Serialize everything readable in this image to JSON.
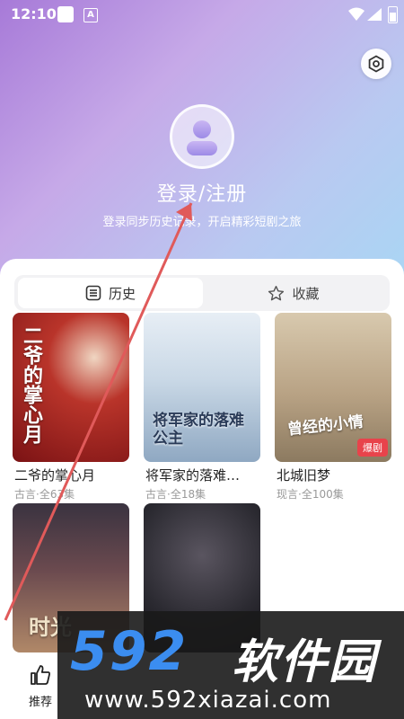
{
  "status_bar": {
    "time": "12:10",
    "notif_icon": "A"
  },
  "header": {
    "settings_icon": "settings-icon",
    "avatar_icon": "user-avatar-icon",
    "login_title": "登录/注册",
    "login_subtitle": "登录同步历史记录，开启精彩短剧之旅"
  },
  "tabs": [
    {
      "label": "历史",
      "icon": "list-icon",
      "active": true
    },
    {
      "label": "收藏",
      "icon": "star-icon",
      "active": false
    }
  ],
  "cards": [
    {
      "title": "二爷的掌心月",
      "meta": "古言·全63集",
      "poster_text": "二爷的掌心月"
    },
    {
      "title": "将军家的落难…",
      "meta": "古言·全18集",
      "poster_text": "将军家的落难公主"
    },
    {
      "title": "北城旧梦",
      "meta": "现言·全100集",
      "poster_text": "曾经的小情",
      "badge": "爆剧"
    },
    {
      "title": "",
      "meta": "",
      "poster_text": "时光"
    },
    {
      "title": "",
      "meta": "",
      "poster_text": ""
    }
  ],
  "bottom_nav": {
    "recommend_label": "推荐",
    "recommend_icon": "thumbs-up-icon"
  },
  "watermark": {
    "number": "592",
    "brand": "软件园",
    "url": "www.592xiazai.com"
  },
  "colors": {
    "accent_red": "#e8434b",
    "watermark_blue": "#3b8df0"
  }
}
